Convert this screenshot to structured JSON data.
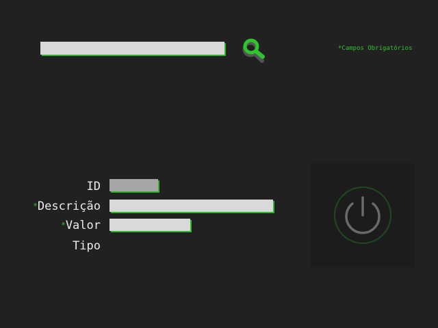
{
  "search": {
    "value": "",
    "icon": "magnifier-icon"
  },
  "required_note": "*Campos Obrigatórios",
  "form": {
    "id": {
      "label": "ID",
      "value": ""
    },
    "descricao": {
      "mark": "*",
      "label": "Descrição",
      "value": ""
    },
    "valor": {
      "mark": "*",
      "label": "Valor",
      "value": ""
    },
    "tipo": {
      "label": "Tipo"
    }
  },
  "power": {
    "icon": "power-icon"
  },
  "colors": {
    "background": "#212121",
    "accent": "#2ec42e",
    "field": "#d9d9d9",
    "field_readonly": "#a6a6a6",
    "panel": "#1c1c1c"
  }
}
